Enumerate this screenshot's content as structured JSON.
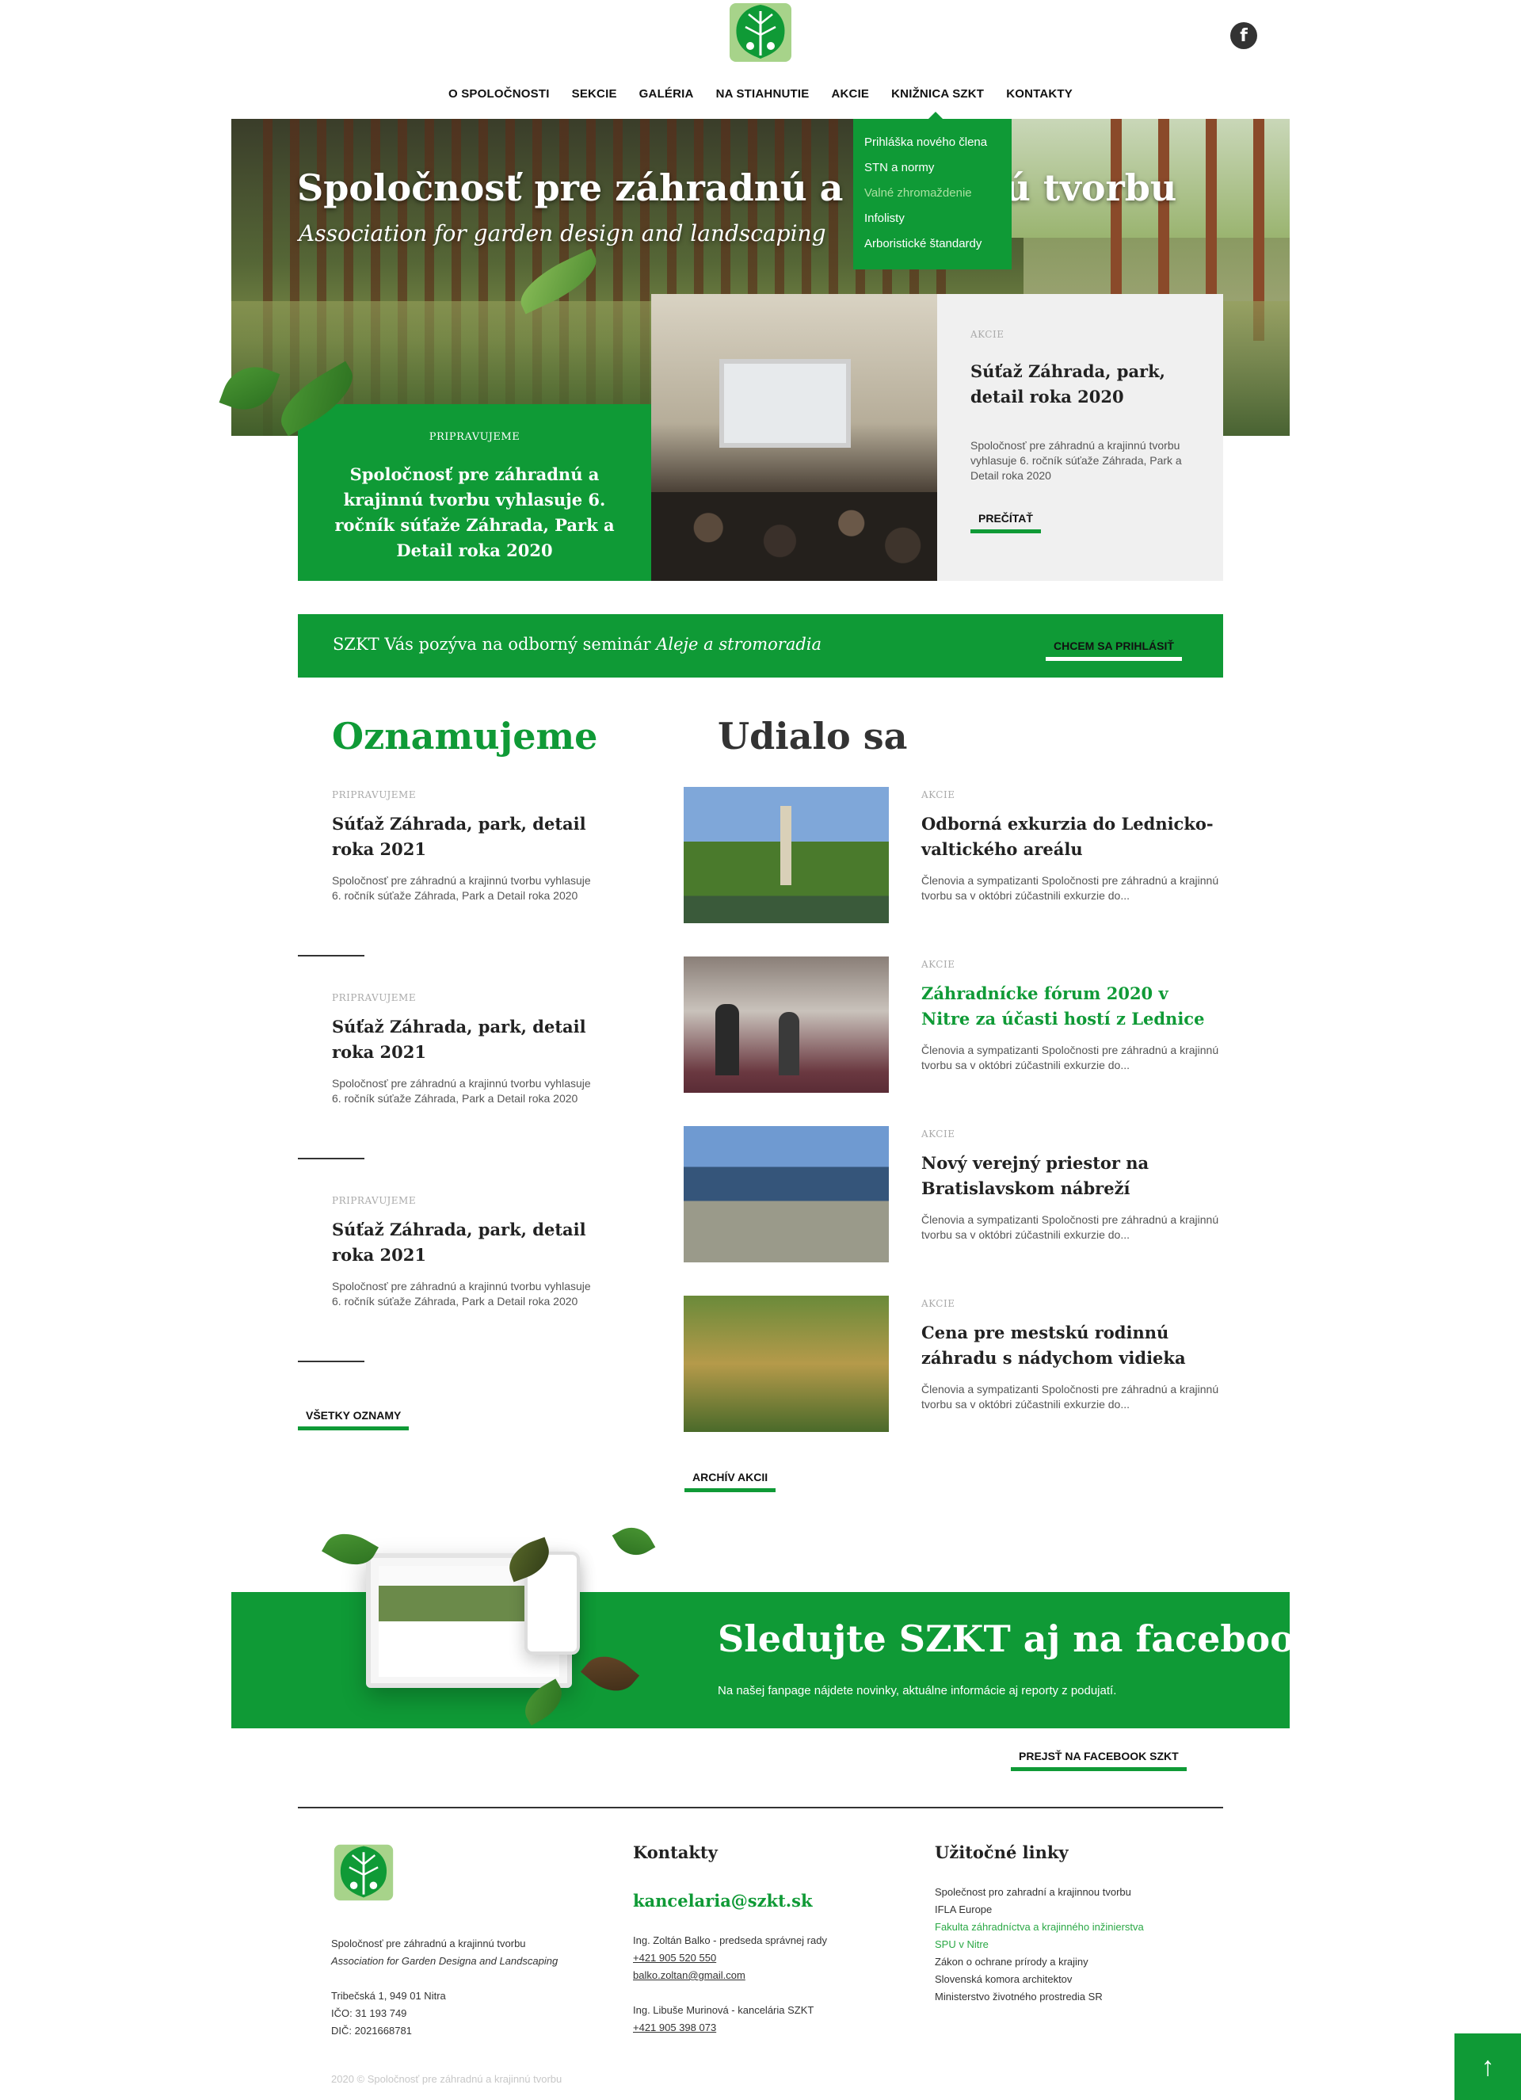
{
  "header": {
    "nav": [
      "O SPOLOČNOSTI",
      "SEKCIE",
      "GALÉRIA",
      "NA STIAHNUTIE",
      "AKCIE",
      "KNIŽNICA SZKT",
      "KONTAKTY"
    ],
    "social_icon": "f"
  },
  "hero": {
    "title": "Spoločnosť pre záhradnú a krajinnú tvorbu",
    "subtitle": "Association for garden design and landscaping"
  },
  "dropdown": {
    "items": [
      "Prihláška nového člena",
      "STN a normy",
      "Valné zhromaždenie",
      "Infolisty",
      "Arboristické štandardy"
    ],
    "active_index": 2
  },
  "featured": {
    "green_tag": "PRIPRAVUJEME",
    "green_text": "Spoločnosť pre záhradnú a krajinnú tvorbu vyhlasuje 6. ročník súťaže Záhrada, Park a Detail roka 2020",
    "card_tag": "AKCIE",
    "card_title": "Súťaž Záhrada, park, detail  roka 2020",
    "card_excerpt": "Spoločnosť pre záhradnú a krajinnú tvorbu vyhlasuje 6. ročník súťaže Záhrada, Park a Detail roka 2020",
    "card_button": "PREČÍTAŤ"
  },
  "seminar": {
    "text": "SZKT Vás pozýva na odborný seminár ",
    "text_italic": "Aleje a stromoradia",
    "button": "CHCEM SA PRIHLÁSIŤ"
  },
  "announcements": {
    "title": "Oznamujeme",
    "items": [
      {
        "tag": "PRIPRAVUJEME",
        "title": "Súťaž Záhrada, park, detail  roka 2021",
        "excerpt": "Spoločnosť pre záhradnú a krajinnú tvorbu vyhlasuje 6. ročník súťaže Záhrada, Park a Detail roka 2020"
      },
      {
        "tag": "PRIPRAVUJEME",
        "title": "Súťaž Záhrada, park, detail  roka 2021",
        "excerpt": "Spoločnosť pre záhradnú a krajinnú tvorbu vyhlasuje 6. ročník súťaže Záhrada, Park a Detail roka 2020"
      },
      {
        "tag": "PRIPRAVUJEME",
        "title": "Súťaž Záhrada, park, detail  roka 2021",
        "excerpt": "Spoločnosť pre záhradnú a krajinnú tvorbu vyhlasuje 6. ročník súťaže Záhrada, Park a Detail roka 2020"
      }
    ],
    "button": "VŠETKY OZNAMY"
  },
  "events": {
    "title": "Udialo sa",
    "items": [
      {
        "tag": "AKCIE",
        "title": "Odborná exkurzia do Lednicko-valtického areálu",
        "excerpt": "Členovia a sympatizanti Spoločnosti pre záhradnú a krajinnú tvorbu sa v októbri zúčastnili exkurzie do..."
      },
      {
        "tag": "AKCIE",
        "title": "Záhradnícke fórum 2020 v Nitre za účasti hostí z Lednice",
        "excerpt": "Členovia a sympatizanti Spoločnosti pre záhradnú a krajinnú tvorbu sa v októbri zúčastnili exkurzie do..."
      },
      {
        "tag": "AKCIE",
        "title": "Nový verejný priestor na Bratislavskom nábreží",
        "excerpt": "Členovia a sympatizanti Spoločnosti pre záhradnú a krajinnú tvorbu sa v októbri zúčastnili exkurzie do..."
      },
      {
        "tag": "AKCIE",
        "title": "Cena pre mestskú rodinnú záhradu s nádychom vidieka",
        "excerpt": "Členovia a sympatizanti Spoločnosti pre záhradnú a krajinnú tvorbu sa v októbri zúčastnili exkurzie do..."
      }
    ],
    "button": "ARCHÍV AKCII"
  },
  "facebook": {
    "title": "Sledujte SZKT aj na facebooku",
    "subtitle": "Na našej fanpage nájdete novinky, aktuálne informácie aj reporty z podujatí.",
    "button": "PREJSŤ NA FACEBOOK SZKT"
  },
  "footer": {
    "org_name": "Spoločnosť pre záhradnú a krajinnú tvorbu",
    "org_name_en": "Association for Garden Designa and Landscaping",
    "address": "Tribečská 1,  949 01 Nitra",
    "ico": "IČO: 31 193 749",
    "dic": "DIČ: 2021668781",
    "contacts_title": "Kontakty",
    "email": "kancelaria@szkt.sk",
    "person1": "Ing. Zoltán Balko - predseda správnej rady",
    "person1_phone": "+421 905 520 550",
    "person1_email": "balko.zoltan@gmail.com",
    "person2": "Ing. Libuše Murinová - kancelária SZKT",
    "person2_phone": "+421 905 398 073",
    "links_title": "Užitočné linky",
    "links": [
      {
        "label": "Společnost pro zahradní a krajinnou tvorbu",
        "highlight": false
      },
      {
        "label": "IFLA Europe",
        "highlight": false
      },
      {
        "label": "Fakulta záhradníctva a krajinného inžinierstva",
        "highlight": true
      },
      {
        "label": "SPU v Nitre",
        "highlight": true
      },
      {
        "label": "Zákon o ochrane prírody a krajiny",
        "highlight": false
      },
      {
        "label": "Slovenská komora architektov",
        "highlight": false
      },
      {
        "label": "Ministerstvo životného prostredia SR",
        "highlight": false
      }
    ],
    "copyright": "2020 © Spoločnosť pre záhradnú a krajinnú tvorbu"
  },
  "colors": {
    "brand_green": "#0f9a36",
    "light_gray": "#f0f0f0"
  },
  "icons": {
    "logo": "szkt-leaf-logo",
    "facebook": "facebook-icon",
    "back_to_top": "arrow-up-icon"
  }
}
